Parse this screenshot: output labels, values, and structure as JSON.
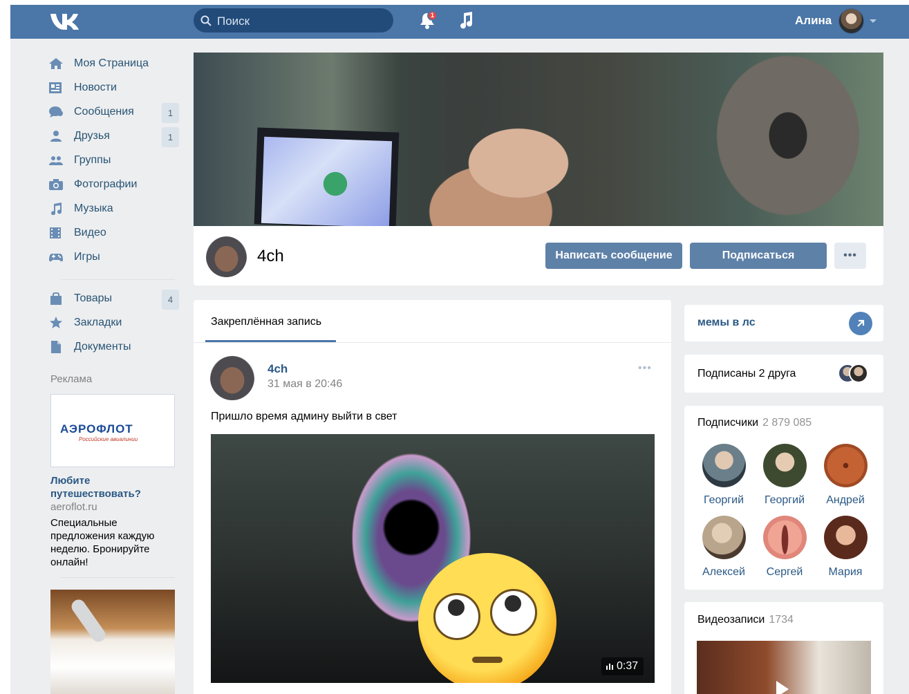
{
  "header": {
    "search_placeholder": "Поиск",
    "notifications_count": "1",
    "user_name": "Алина"
  },
  "sidebar": {
    "items": [
      {
        "label": "Моя Страница",
        "icon": "home-icon",
        "count": ""
      },
      {
        "label": "Новости",
        "icon": "news-icon",
        "count": ""
      },
      {
        "label": "Сообщения",
        "icon": "messages-icon",
        "count": "1"
      },
      {
        "label": "Друзья",
        "icon": "friends-icon",
        "count": "1"
      },
      {
        "label": "Группы",
        "icon": "groups-icon",
        "count": ""
      },
      {
        "label": "Фотографии",
        "icon": "camera-icon",
        "count": ""
      },
      {
        "label": "Музыка",
        "icon": "music-icon",
        "count": ""
      },
      {
        "label": "Видео",
        "icon": "video-icon",
        "count": ""
      },
      {
        "label": "Игры",
        "icon": "gamepad-icon",
        "count": ""
      }
    ],
    "extra_items": [
      {
        "label": "Товары",
        "icon": "bag-icon",
        "count": "4"
      },
      {
        "label": "Закладки",
        "icon": "star-icon",
        "count": ""
      },
      {
        "label": "Документы",
        "icon": "document-icon",
        "count": ""
      }
    ],
    "ad": {
      "label": "Реклама",
      "brand": "АЭРОФЛОТ",
      "brand_sub": "Российские авиалинии",
      "title": "Любите путешествовать?",
      "domain": "aeroflot.ru",
      "text": "Специальные предложения каждую неделю. Бронируйте онлайн!"
    }
  },
  "profile": {
    "name": "4ch",
    "message_button": "Написать сообщение",
    "subscribe_button": "Подписаться",
    "more_button": "•••"
  },
  "wall": {
    "tab": "Закреплённая запись",
    "post": {
      "author": "4ch",
      "date": "31 мая в 20:46",
      "more": "•••",
      "text": "Пришло время админу выйти в свет",
      "video_duration": "0:37"
    }
  },
  "right": {
    "memes_link": "мемы в лс",
    "friends_subscribed": "Подписаны 2 друга",
    "subscribers": {
      "title": "Подписчики",
      "count": "2 879 085",
      "people": [
        {
          "name": "Георгий",
          "color": "#6a7f8a"
        },
        {
          "name": "Георгий",
          "color": "#3d4a2f"
        },
        {
          "name": "Андрей",
          "color": "#a04a25"
        },
        {
          "name": "Алексей",
          "color": "#b9a58c"
        },
        {
          "name": "Сергей",
          "color": "#e0867a"
        },
        {
          "name": "Мария",
          "color": "#5a2a1c"
        }
      ]
    },
    "videos": {
      "title": "Видеозаписи",
      "count": "1734"
    }
  },
  "colors": {
    "header_bg": "#4a76a8",
    "link": "#2a5885",
    "button": "#5e81a8",
    "page_bg": "#edeef0"
  }
}
